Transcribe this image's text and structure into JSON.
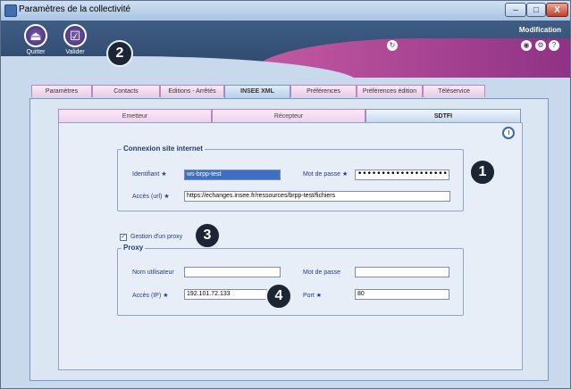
{
  "window": {
    "title": "Paramètres de la collectivité",
    "buttons": {
      "minimize": "–",
      "maximize": "□",
      "close": "X"
    }
  },
  "toolbar": {
    "quit_label": "Quitter",
    "validate_label": "Valider",
    "mode_label": "Modification",
    "quit_icon": "door-exit-icon",
    "validate_icon": "checkbox-icon"
  },
  "callouts": [
    "1",
    "2",
    "3",
    "4"
  ],
  "main_tabs": [
    "Paramètres",
    "Contacts",
    "Editions - Arrêtés",
    "INSEE XML",
    "Préférences",
    "Préférences édition",
    "Téléservice"
  ],
  "active_main_tab": "INSEE XML",
  "sub_tabs": [
    "Emetteur",
    "Récepteur",
    "SDTFI"
  ],
  "active_sub_tab": "SDTFI",
  "connexion": {
    "legend": "Connexion site internet",
    "identifiant_label": "Identifiant",
    "identifiant_value": "ws-brpp-test",
    "password_label": "Mot de passe",
    "password_value": "••••••••••••••••••••",
    "url_label": "Accès (url)",
    "url_value": "https://echanges.insee.fr/ressources/brpp-test/fichiers",
    "required_mark": "★"
  },
  "proxy": {
    "checkbox_label": "Gestion d'un proxy",
    "checked": true,
    "legend": "Proxy",
    "user_label": "Nom utilisateur",
    "user_value": "",
    "password_label": "Mot de passe",
    "password_value": "",
    "ip_label": "Accès (IP)",
    "ip_value": "192.101.72.133",
    "port_label": "Port",
    "port_value": "80",
    "required_mark": "★"
  }
}
